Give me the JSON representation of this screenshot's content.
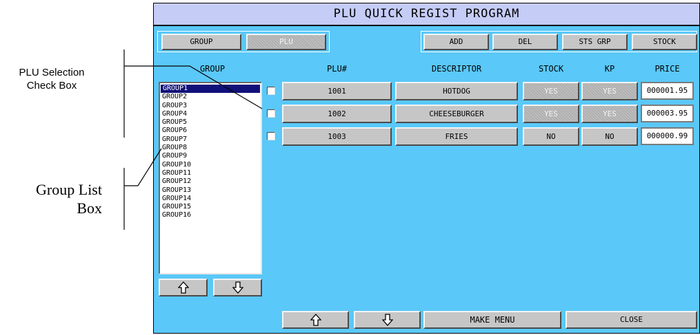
{
  "annotations": {
    "plu_selection_line1": "PLU Selection",
    "plu_selection_line2": "Check Box",
    "group_list_line1": "Group List",
    "group_list_line2": "Box"
  },
  "window": {
    "title": "PLU QUICK REGIST PROGRAM"
  },
  "mode_tabs": {
    "group": "GROUP",
    "plu": "PLU"
  },
  "toolbar": {
    "add": "ADD",
    "del": "DEL",
    "sts_grp": "STS GRP",
    "stock": "STOCK"
  },
  "headers": {
    "group": "GROUP",
    "plu": "PLU#",
    "descriptor": "DESCRIPTOR",
    "stock": "STOCK",
    "kp": "KP",
    "price": "PRICE"
  },
  "groups": [
    "GROUP1",
    "GROUP2",
    "GROUP3",
    "GROUP4",
    "GROUP5",
    "GROUP6",
    "GROUP7",
    "GROUP8",
    "GROUP9",
    "GROUP10",
    "GROUP11",
    "GROUP12",
    "GROUP13",
    "GROUP14",
    "GROUP15",
    "GROUP16"
  ],
  "selected_group": "GROUP1",
  "rows": [
    {
      "plu": "1001",
      "descriptor": "HOTDOG",
      "stock": "YES",
      "kp": "YES",
      "price": "000001.95"
    },
    {
      "plu": "1002",
      "descriptor": "CHEESEBURGER",
      "stock": "YES",
      "kp": "YES",
      "price": "000003.95"
    },
    {
      "plu": "1003",
      "descriptor": "FRIES",
      "stock": "NO",
      "kp": "NO",
      "price": "000000.99"
    }
  ],
  "bottom": {
    "up_icon": "up-arrow-icon",
    "down_icon": "down-arrow-icon",
    "make_menu": "MAKE MENU",
    "close": "CLOSE"
  },
  "group_scroll": {
    "up_icon": "up-arrow-icon",
    "down_icon": "down-arrow-icon"
  }
}
